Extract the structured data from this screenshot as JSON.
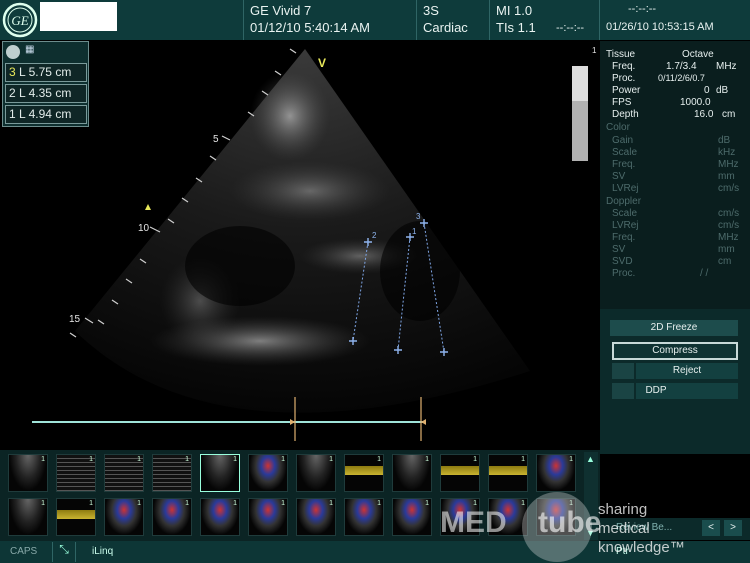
{
  "header": {
    "system": "GE Vivid 7",
    "exam_datetime": "01/12/10 5:40:14 AM",
    "probe": "3S",
    "preset": "Cardiac",
    "mi": "MI 1.0",
    "tis": "TIs 1.1",
    "timer": "--:--:--",
    "current_datetime": "01/26/10 10:53:15 AM",
    "top_right_timer": "--:--:--"
  },
  "measurements": {
    "items": [
      {
        "index": "3",
        "label": "L",
        "value": "5.75",
        "unit": "cm"
      },
      {
        "index": "2",
        "label": "L",
        "value": "4.35",
        "unit": "cm"
      },
      {
        "index": "1",
        "label": "L",
        "value": "4.94",
        "unit": "cm"
      }
    ]
  },
  "image": {
    "depth_marks": [
      "5",
      "10",
      "15"
    ],
    "orientation_marker": "V",
    "point_labels": [
      "1",
      "2",
      "3"
    ],
    "grayscale_top": "1"
  },
  "params": {
    "tissue_label": "Tissue",
    "tissue_value": "Octave",
    "rows": [
      {
        "label": "Freq.",
        "value": "1.7/3.4",
        "unit": "MHz"
      },
      {
        "label": "Proc.",
        "value": "0/11/2/6/0.7",
        "unit": ""
      },
      {
        "label": "Power",
        "value": "0",
        "unit": "dB"
      },
      {
        "label": "FPS",
        "value": "1000.0",
        "unit": ""
      },
      {
        "label": "Depth",
        "value": "16.0",
        "unit": "cm"
      }
    ],
    "color_label": "Color",
    "color_rows": [
      {
        "label": "Gain",
        "unit": "dB"
      },
      {
        "label": "Scale",
        "unit": "kHz"
      },
      {
        "label": "Freq.",
        "unit": "MHz"
      },
      {
        "label": "SV",
        "unit": "mm"
      },
      {
        "label": "LVRej",
        "unit": "cm/s"
      }
    ],
    "doppler_label": "Doppler",
    "doppler_rows": [
      {
        "label": "Scale",
        "unit": "cm/s"
      },
      {
        "label": "LVRej",
        "unit": "cm/s"
      },
      {
        "label": "Freq.",
        "unit": "MHz"
      },
      {
        "label": "SV",
        "unit": "mm"
      },
      {
        "label": "SVD",
        "unit": "cm"
      },
      {
        "label": "Proc.",
        "unit": "/ /"
      }
    ]
  },
  "controls": {
    "freeze": "2D Freeze",
    "compress": "Compress",
    "reject": "Reject",
    "ddp": "DDP",
    "review": "Review Be...",
    "prev": "<",
    "next": ">"
  },
  "footer": {
    "caps": "CAPS",
    "iling": "iLinq",
    "ptr": "Ptr"
  },
  "watermark": {
    "brand_left": "MED",
    "brand_right": "tube",
    "line1": "sharing",
    "line2": "medical",
    "line3": "knowledge™"
  },
  "thumb_num": "1",
  "colors": {
    "panel": "#0e3b3b",
    "measure_line": "#7fa6e6",
    "timeline": "#9fe3d9",
    "cursor": "#e0b070"
  }
}
